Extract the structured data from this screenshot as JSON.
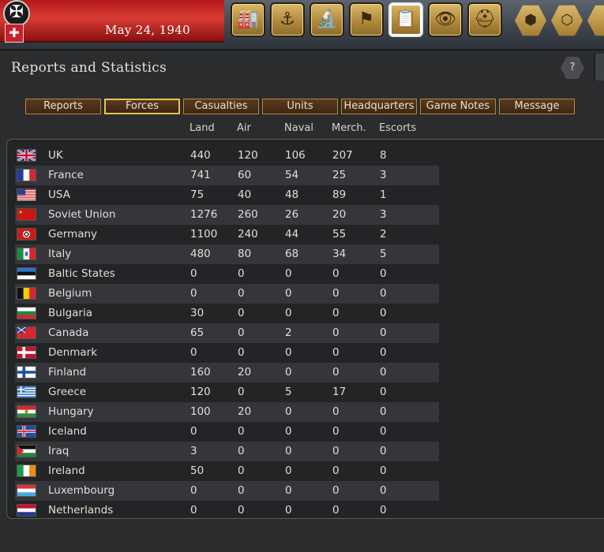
{
  "header": {
    "date": "May 24, 1940",
    "toolbar": [
      {
        "name": "production-icon",
        "glyph": "🏭"
      },
      {
        "name": "naval-icon",
        "glyph": "⚓"
      },
      {
        "name": "research-icon",
        "glyph": "🔬"
      },
      {
        "name": "diplomacy-flag-icon",
        "glyph": "⚑"
      },
      {
        "name": "reports-icon",
        "glyph": "📋",
        "active": true
      },
      {
        "name": "intelligence-binoculars-icon",
        "glyph": "👁"
      },
      {
        "name": "army-helmet-icon",
        "glyph": "⛑"
      }
    ],
    "hex_buttons": [
      {
        "name": "hex-map-icon",
        "glyph": "⬢"
      },
      {
        "name": "hex-grid-icon",
        "glyph": "⬡"
      }
    ]
  },
  "panel": {
    "title": "Reports and Statistics",
    "help_label": "?",
    "tabs": [
      {
        "label": "Reports",
        "name": "tab-reports"
      },
      {
        "label": "Forces",
        "name": "tab-forces",
        "active": true
      },
      {
        "label": "Casualties",
        "name": "tab-casualties"
      },
      {
        "label": "Units",
        "name": "tab-units"
      },
      {
        "label": "Headquarters",
        "name": "tab-headquarters"
      },
      {
        "label": "Game Notes",
        "name": "tab-game-notes"
      },
      {
        "label": "Message",
        "name": "tab-message"
      }
    ],
    "columns": [
      "Land",
      "Air",
      "Naval",
      "Merch.",
      "Escorts"
    ],
    "rows": [
      {
        "country": "UK",
        "flag": "uk",
        "land": "440",
        "air": "120",
        "naval": "106",
        "merch": "207",
        "escorts": "8"
      },
      {
        "country": "France",
        "flag": "france",
        "land": "741",
        "air": "60",
        "naval": "54",
        "merch": "25",
        "escorts": "3"
      },
      {
        "country": "USA",
        "flag": "usa",
        "land": "75",
        "air": "40",
        "naval": "48",
        "merch": "89",
        "escorts": "1"
      },
      {
        "country": "Soviet Union",
        "flag": "soviet",
        "land": "1276",
        "air": "260",
        "naval": "26",
        "merch": "20",
        "escorts": "3"
      },
      {
        "country": "Germany",
        "flag": "germany",
        "land": "1100",
        "air": "240",
        "naval": "44",
        "merch": "55",
        "escorts": "2"
      },
      {
        "country": "Italy",
        "flag": "italy",
        "land": "480",
        "air": "80",
        "naval": "68",
        "merch": "34",
        "escorts": "5"
      },
      {
        "country": "Baltic States",
        "flag": "estonia",
        "land": "0",
        "air": "0",
        "naval": "0",
        "merch": "0",
        "escorts": "0"
      },
      {
        "country": "Belgium",
        "flag": "belgium",
        "land": "0",
        "air": "0",
        "naval": "0",
        "merch": "0",
        "escorts": "0"
      },
      {
        "country": "Bulgaria",
        "flag": "bulgaria",
        "land": "30",
        "air": "0",
        "naval": "0",
        "merch": "0",
        "escorts": "0"
      },
      {
        "country": "Canada",
        "flag": "canada",
        "land": "65",
        "air": "0",
        "naval": "2",
        "merch": "0",
        "escorts": "0"
      },
      {
        "country": "Denmark",
        "flag": "denmark",
        "land": "0",
        "air": "0",
        "naval": "0",
        "merch": "0",
        "escorts": "0"
      },
      {
        "country": "Finland",
        "flag": "finland",
        "land": "160",
        "air": "20",
        "naval": "0",
        "merch": "0",
        "escorts": "0"
      },
      {
        "country": "Greece",
        "flag": "greece",
        "land": "120",
        "air": "0",
        "naval": "5",
        "merch": "17",
        "escorts": "0"
      },
      {
        "country": "Hungary",
        "flag": "hungary",
        "land": "100",
        "air": "20",
        "naval": "0",
        "merch": "0",
        "escorts": "0"
      },
      {
        "country": "Iceland",
        "flag": "iceland",
        "land": "0",
        "air": "0",
        "naval": "0",
        "merch": "0",
        "escorts": "0"
      },
      {
        "country": "Iraq",
        "flag": "iraq",
        "land": "3",
        "air": "0",
        "naval": "0",
        "merch": "0",
        "escorts": "0"
      },
      {
        "country": "Ireland",
        "flag": "ireland",
        "land": "50",
        "air": "0",
        "naval": "0",
        "merch": "0",
        "escorts": "0"
      },
      {
        "country": "Luxembourg",
        "flag": "luxembourg",
        "land": "0",
        "air": "0",
        "naval": "0",
        "merch": "0",
        "escorts": "0"
      },
      {
        "country": "Netherlands",
        "flag": "netherlands",
        "land": "0",
        "air": "0",
        "naval": "0",
        "merch": "0",
        "escorts": "0"
      }
    ]
  }
}
